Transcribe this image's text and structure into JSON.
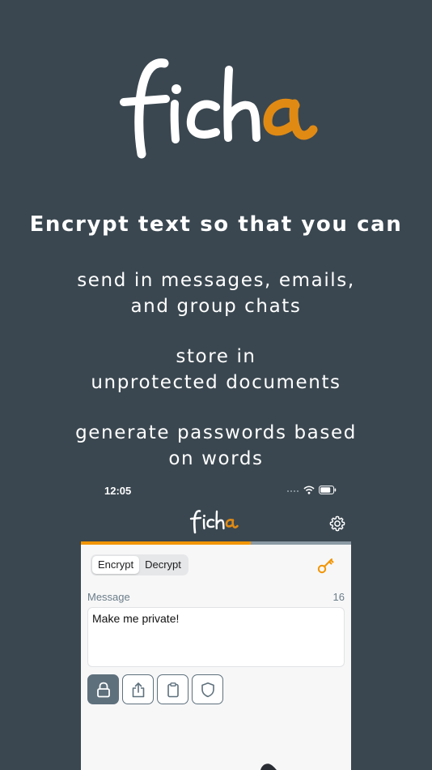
{
  "hero": {
    "headline": "Encrypt text so that you can",
    "features": [
      "send in messages, emails,",
      "and group chats",
      "store in",
      "unprotected documents",
      "generate passwords based",
      "on words"
    ]
  },
  "statusbar": {
    "time": "12:05"
  },
  "app": {
    "encryption_progress": 0.63,
    "tabs": {
      "encrypt": "Encrypt",
      "decrypt": "Decrypt",
      "selected": "Encrypt"
    },
    "message": {
      "label": "Message",
      "count": "16",
      "value": "Make me private!"
    },
    "icons": {
      "settings": "gear-icon",
      "key": "key-icon",
      "lock": "lock-icon",
      "share": "share-icon",
      "clipboard": "clipboard-icon",
      "shield": "shield-icon"
    }
  },
  "colors": {
    "background": "#3a4750",
    "accent": "#f29500",
    "button": "#5e707c",
    "panel": "#f7f7f8"
  }
}
